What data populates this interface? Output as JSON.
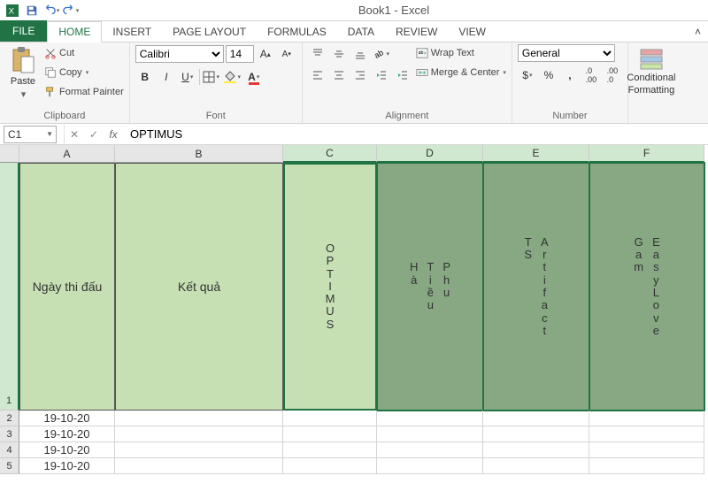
{
  "app": {
    "title": "Book1 - Excel"
  },
  "tabs": {
    "file": "FILE",
    "items": [
      "HOME",
      "INSERT",
      "PAGE LAYOUT",
      "FORMULAS",
      "DATA",
      "REVIEW",
      "VIEW"
    ],
    "active": 0
  },
  "ribbon": {
    "clipboard": {
      "paste": "Paste",
      "cut": "Cut",
      "copy": "Copy",
      "painter": "Format Painter",
      "label": "Clipboard"
    },
    "font": {
      "name": "Calibri",
      "size": "14",
      "label": "Font"
    },
    "alignment": {
      "wrap": "Wrap Text",
      "merge": "Merge & Center",
      "label": "Alignment"
    },
    "number": {
      "format": "General",
      "label": "Number"
    },
    "styles": {
      "cond": "Conditional",
      "cond2": "Formatting"
    }
  },
  "formula": {
    "cellref": "C1",
    "value": "OPTIMUS"
  },
  "grid": {
    "cols": [
      "A",
      "B",
      "C",
      "D",
      "E",
      "F"
    ],
    "row1": {
      "A": "Ngày thi đấu",
      "B": "Kết quả",
      "C": "OPTIMUS",
      "D1": "Hà",
      "D2": "Tiều",
      "D3": "Phu",
      "E1": "TS",
      "E2": "Artifact",
      "F1": "Gam",
      "F2": "EasyLove"
    },
    "rows": [
      {
        "n": "2",
        "A": "19-10-20"
      },
      {
        "n": "3",
        "A": "19-10-20"
      },
      {
        "n": "4",
        "A": "19-10-20"
      },
      {
        "n": "5",
        "A": "19-10-20"
      }
    ]
  }
}
